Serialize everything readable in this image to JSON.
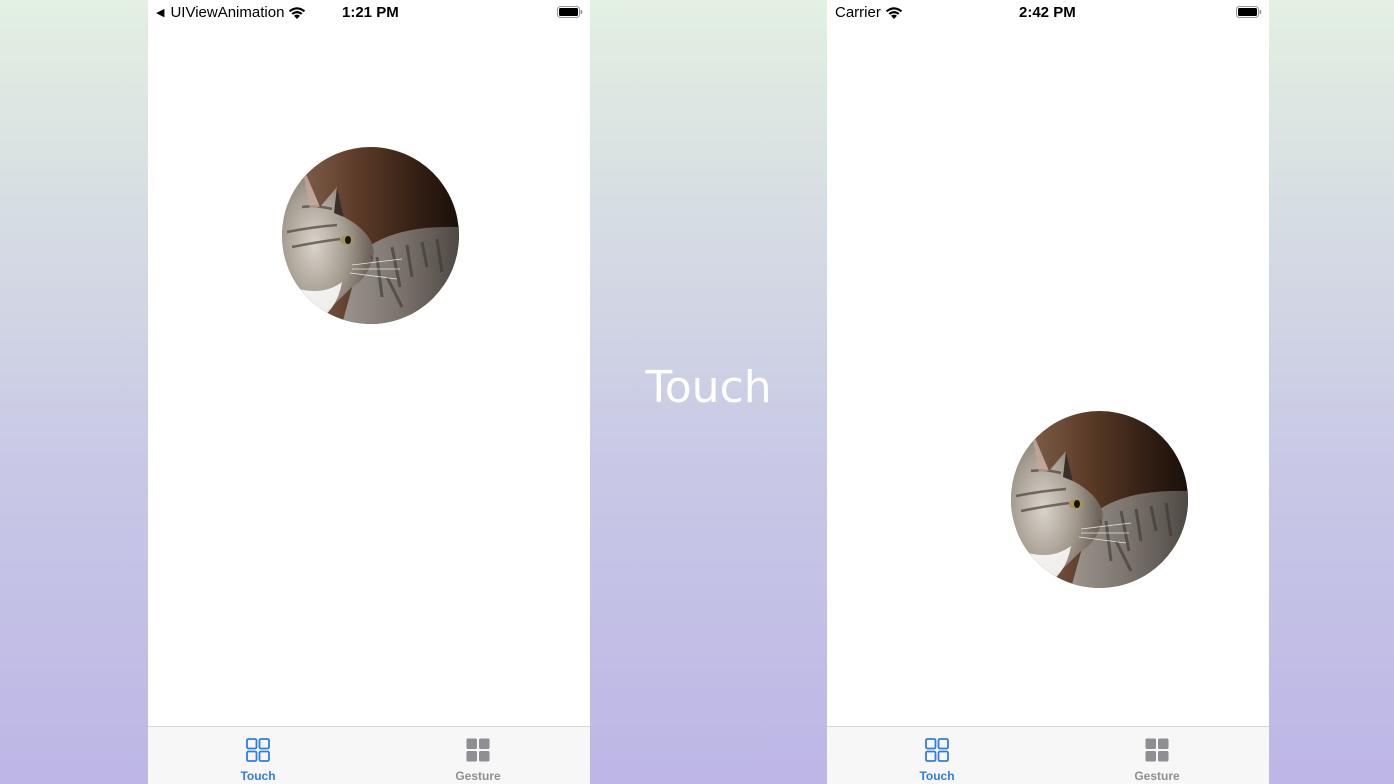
{
  "caption": "Touch",
  "colors": {
    "tab_active": "#2f7de1",
    "tab_inactive": "#8e8e93"
  },
  "phones": [
    {
      "status": {
        "left_text": "UIViewAnimation",
        "back_indicator": "back-triangle-icon",
        "time": "1:21 PM"
      },
      "image": "cat-photo",
      "tabs": [
        {
          "label": "Touch",
          "icon": "grid-outline-icon",
          "selected": true
        },
        {
          "label": "Gesture",
          "icon": "grid-filled-icon",
          "selected": false
        }
      ]
    },
    {
      "status": {
        "left_text": "Carrier",
        "time": "2:42 PM"
      },
      "image": "cat-photo",
      "tabs": [
        {
          "label": "Touch",
          "icon": "grid-outline-icon",
          "selected": true
        },
        {
          "label": "Gesture",
          "icon": "grid-filled-icon",
          "selected": false
        }
      ]
    }
  ]
}
